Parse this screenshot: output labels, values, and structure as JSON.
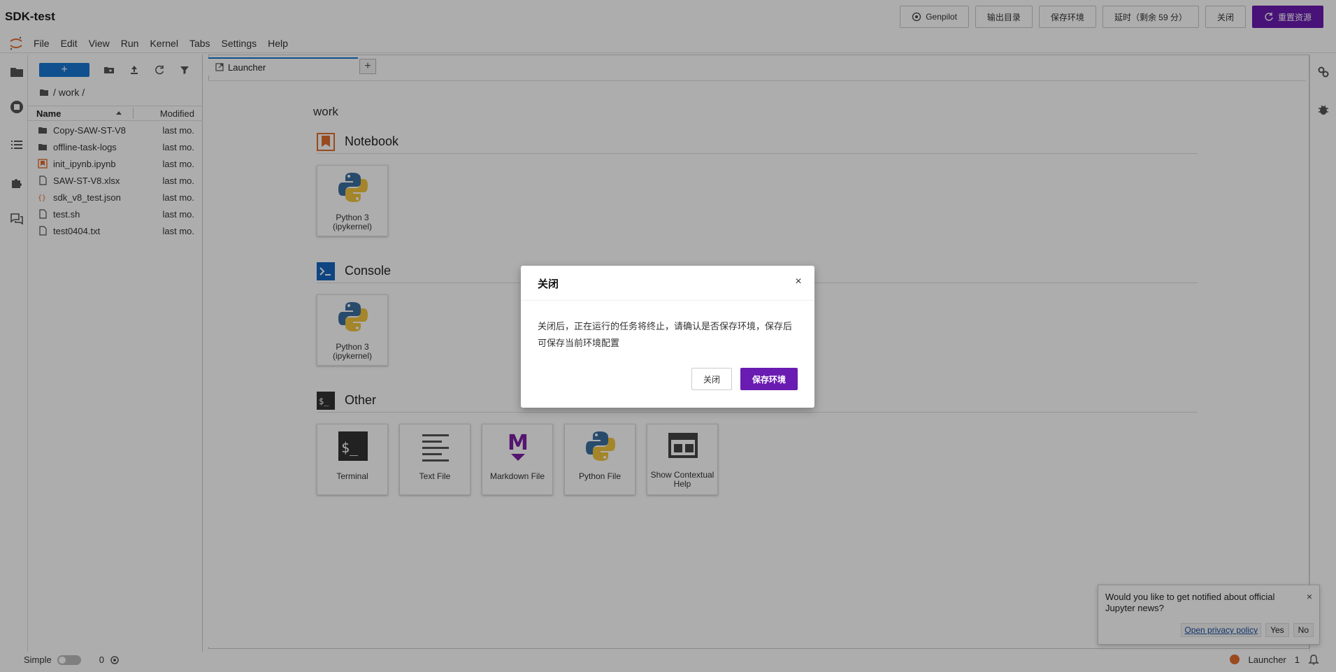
{
  "app": {
    "title": "SDK-test"
  },
  "header": {
    "genpilot": "Genpilot",
    "output_dir": "输出目录",
    "save_env": "保存环境",
    "extend": "延时（剩余 59 分）",
    "close": "关闭",
    "reset": "重置资源"
  },
  "menu": [
    "File",
    "Edit",
    "View",
    "Run",
    "Kernel",
    "Tabs",
    "Settings",
    "Help"
  ],
  "filebrowser": {
    "new_label": "+",
    "breadcrumb": "/ work /",
    "col_name": "Name",
    "col_modified": "Modified",
    "files": [
      {
        "name": "Copy-SAW-ST-V8",
        "modified": "last mo.",
        "type": "folder"
      },
      {
        "name": "offline-task-logs",
        "modified": "last mo.",
        "type": "folder"
      },
      {
        "name": "init_ipynb.ipynb",
        "modified": "last mo.",
        "type": "notebook"
      },
      {
        "name": "SAW-ST-V8.xlsx",
        "modified": "last mo.",
        "type": "file"
      },
      {
        "name": "sdk_v8_test.json",
        "modified": "last mo.",
        "type": "json"
      },
      {
        "name": "test.sh",
        "modified": "last mo.",
        "type": "file"
      },
      {
        "name": "test0404.txt",
        "modified": "last mo.",
        "type": "file"
      }
    ]
  },
  "tabs": {
    "launcher": "Launcher",
    "add": "+"
  },
  "launcher": {
    "cwd": "work",
    "notebook": {
      "title": "Notebook",
      "cards": [
        {
          "label": "Python 3 (ipykernel)"
        }
      ]
    },
    "console": {
      "title": "Console",
      "cards": [
        {
          "label": "Python 3 (ipykernel)"
        }
      ]
    },
    "other": {
      "title": "Other",
      "cards": [
        {
          "label": "Terminal"
        },
        {
          "label": "Text File"
        },
        {
          "label": "Markdown File"
        },
        {
          "label": "Python File"
        },
        {
          "label": "Show Contextual Help"
        }
      ]
    }
  },
  "modal": {
    "title": "关闭",
    "close_glyph": "×",
    "body": "关闭后，正在运行的任务将终止，请确认是否保存环境，保存后可保存当前环境配置",
    "cancel": "关闭",
    "confirm": "保存环境"
  },
  "notification": {
    "text": "Would you like to get notified about official Jupyter news?",
    "close_glyph": "×",
    "privacy": "Open privacy policy",
    "yes": "Yes",
    "no": "No"
  },
  "status": {
    "mode": "Simple",
    "kernels": "0",
    "active": "Launcher",
    "count": "1"
  },
  "colors": {
    "accent": "#6a1bb1",
    "blue": "#1976d2",
    "orange": "#e46e2e"
  }
}
